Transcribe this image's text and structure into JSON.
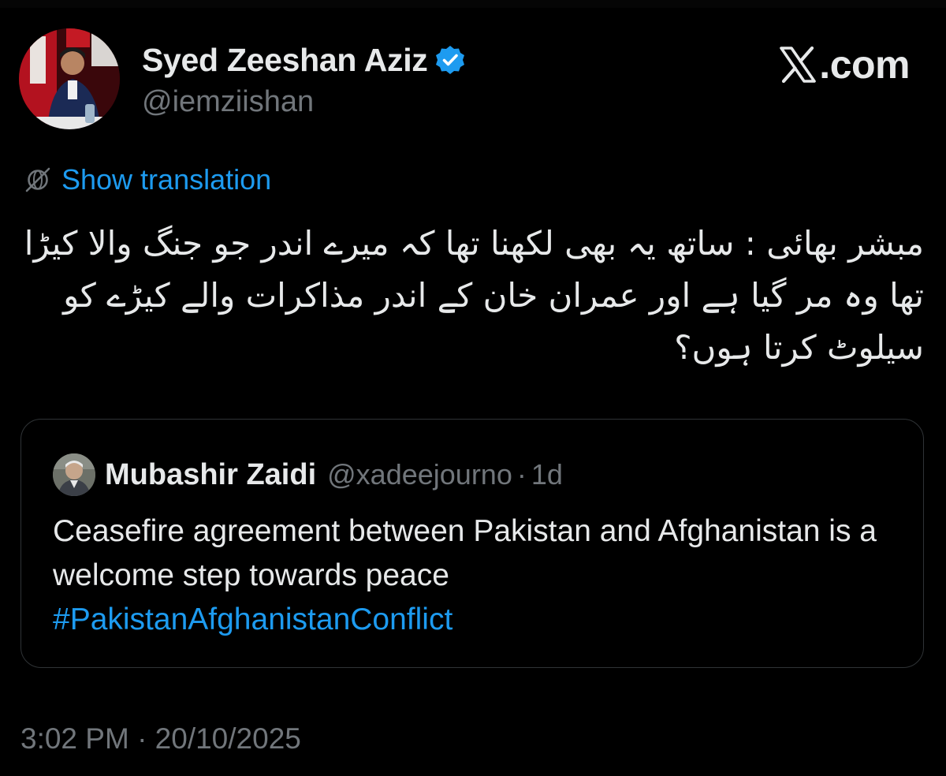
{
  "author": {
    "display_name": "Syed Zeeshan Aziz",
    "handle": "@iemziishan",
    "verified_icon": "verified-badge-icon",
    "avatar": "profile-photo"
  },
  "brand": {
    "logo_icon": "x-logo-icon",
    "suffix": ".com"
  },
  "translation": {
    "icon": "globe-icon",
    "label": "Show translation"
  },
  "tweet": {
    "text": "مبشر بھائی : ساتھ یہ بھی لکھنا تھا کہ میرے اندر جو جنگ والا کیڑا تھا وہ مر گیا ہے اور عمران خان کے اندر مذاکرات والے کیڑے کو سیلوٹ کرتا ہوں؟"
  },
  "quoted_tweet": {
    "author_name": "Mubashir Zaidi",
    "handle": "@xadeejourno",
    "separator": "·",
    "time": "1d",
    "text": "Ceasefire agreement between Pakistan and Afghanistan is a welcome step towards peace",
    "hashtag": "#PakistanAfghanistanConflict"
  },
  "timestamp": "3:02 PM · 20/10/2025",
  "colors": {
    "background": "#000000",
    "text_primary": "#e7e9ea",
    "text_secondary": "#71767b",
    "accent": "#1d9bf0",
    "border": "#2f3336"
  }
}
